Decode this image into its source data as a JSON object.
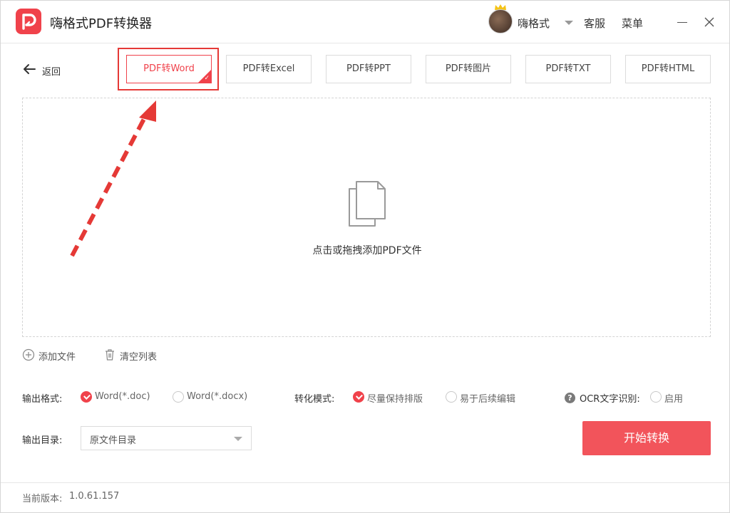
{
  "app": {
    "title": "嗨格式PDF转换器",
    "brand_color": "#f0424b",
    "logo_icon": "pdf-logo-icon"
  },
  "header": {
    "username": "嗨格式",
    "service_label": "客服",
    "menu_label": "菜单"
  },
  "nav": {
    "back_label": "返回"
  },
  "tabs": [
    {
      "label": "PDF转Word",
      "active": true
    },
    {
      "label": "PDF转Excel",
      "active": false
    },
    {
      "label": "PDF转PPT",
      "active": false
    },
    {
      "label": "PDF转图片",
      "active": false
    },
    {
      "label": "PDF转TXT",
      "active": false
    },
    {
      "label": "PDF转HTML",
      "active": false
    }
  ],
  "dropzone": {
    "text": "点击或拖拽添加PDF文件"
  },
  "file_actions": {
    "add_label": "添加文件",
    "clear_label": "清空列表"
  },
  "output_format": {
    "label": "输出格式:",
    "options": [
      {
        "label": "Word(*.doc)",
        "checked": true
      },
      {
        "label": "Word(*.docx)",
        "checked": false
      }
    ]
  },
  "convert_mode": {
    "label": "转化模式:",
    "options": [
      {
        "label": "尽量保持排版",
        "checked": true
      },
      {
        "label": "易于后续编辑",
        "checked": false
      }
    ]
  },
  "ocr": {
    "label": "OCR文字识别:",
    "enable_label": "启用",
    "checked": false
  },
  "output_dir": {
    "label": "输出目录:",
    "value": "原文件目录"
  },
  "start_button": {
    "label": "开始转换"
  },
  "footer": {
    "version_label": "当前版本:",
    "version": "1.0.61.157"
  }
}
